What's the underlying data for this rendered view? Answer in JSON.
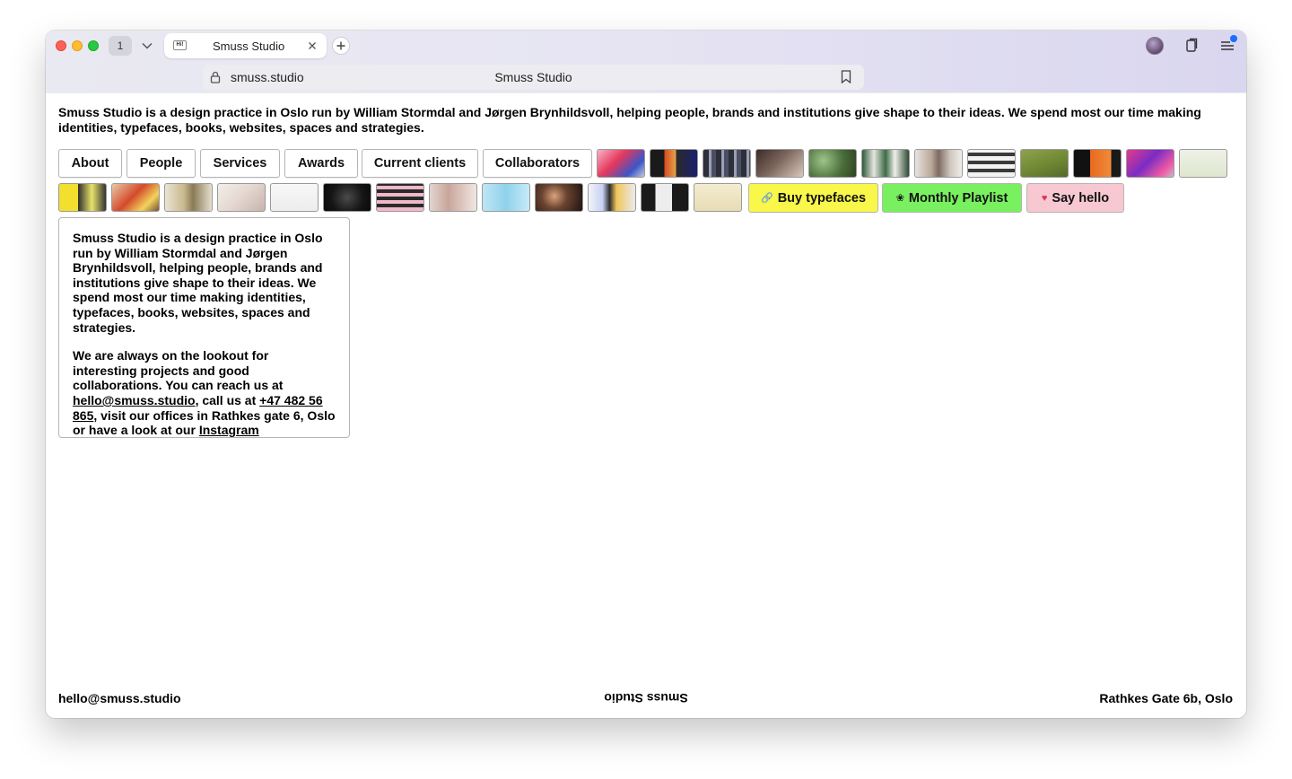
{
  "browser": {
    "tab_count": "1",
    "tab_title": "Smuss Studio",
    "favicon_text": "Hi!",
    "url": "smuss.studio",
    "page_title": "Smuss Studio"
  },
  "page": {
    "intro": "Smuss Studio is a design practice in Oslo run by William Stormdal and Jørgen Brynhildsvoll, helping people, brands and institutions give shape to their ideas. We spend most our time making identities, typefaces, books, websites, spaces and strategies.",
    "nav": [
      "About",
      "People",
      "Services",
      "Awards",
      "Current clients",
      "Collaborators"
    ],
    "links": {
      "buy_typefaces": "Buy typefaces",
      "monthly_playlist": "Monthly Playlist",
      "say_hello": "Say hello"
    },
    "link_colors": {
      "buy_typefaces": "#f8f74a",
      "monthly_playlist": "#79f05f",
      "say_hello": "#f7c8d2"
    },
    "about_panel": {
      "paragraph1": "Smuss Studio is a design practice in Oslo run by William Stormdal and Jørgen Brynhildsvoll, helping people, brands and institutions give shape to their ideas. We spend most our time making identities, typefaces, books, websites, spaces and strategies.",
      "p2_part1": "We are always on the lookout for interesting projects and good collaborations. You can reach us at ",
      "email": "hello@smuss.studio",
      "p2_part2": ", call us at ",
      "phone": "+47 482 56 865",
      "p2_part3": ", visit our offices in Rathkes gate 6, Oslo or have a look at our ",
      "instagram": "Instagram"
    },
    "footer": {
      "email": "hello@smuss.studio",
      "name": "Smuss Studio",
      "address": "Rathkes Gate 6b, Oslo"
    }
  }
}
